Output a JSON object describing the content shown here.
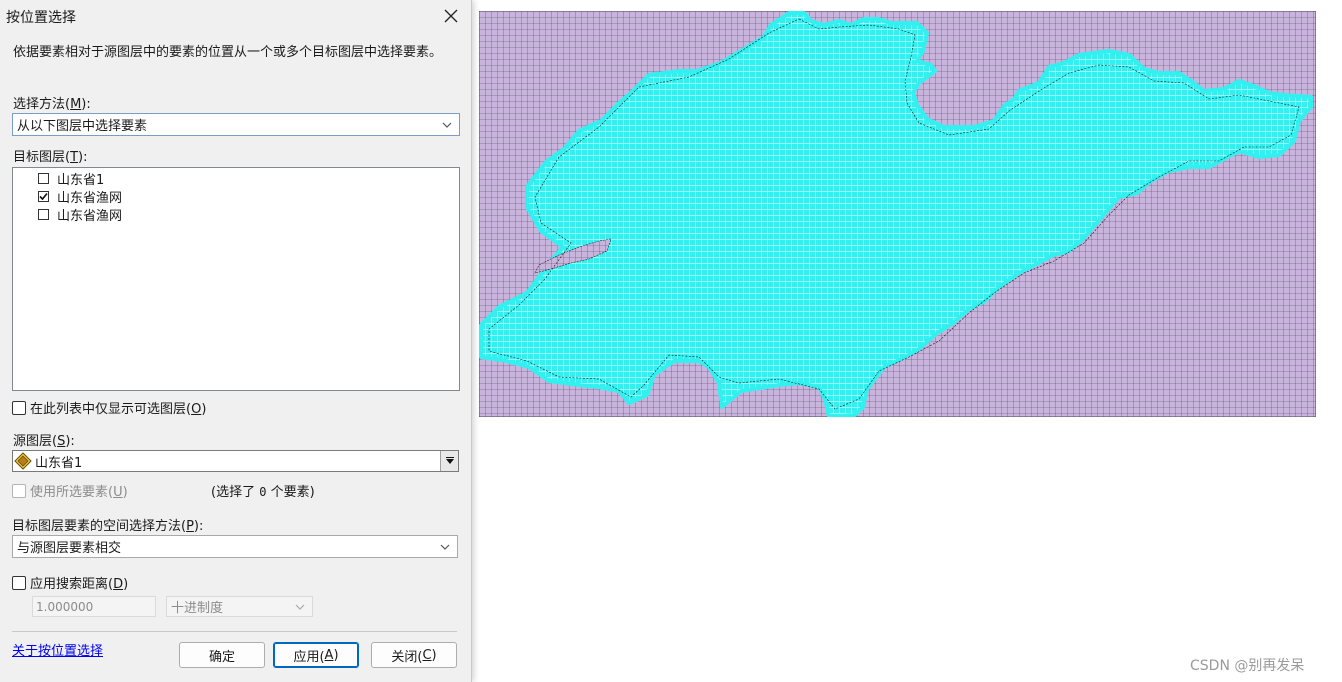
{
  "dialog": {
    "title": "按位置选择",
    "description": "依据要素相对于源图层中的要素的位置从一个或多个目标图层中选择要素。",
    "selection_method": {
      "label": "选择方法(",
      "key": "M",
      "label_end": "):",
      "value": "从以下图层中选择要素"
    },
    "target_layers": {
      "label": "目标图层(",
      "key": "T",
      "label_end": "):",
      "items": [
        {
          "label": "山东省1",
          "checked": false
        },
        {
          "label": "山东省渔网",
          "checked": true
        },
        {
          "label": "山东省渔网",
          "checked": false
        }
      ]
    },
    "only_selectable": {
      "label": "在此列表中仅显示可选图层(",
      "key": "O",
      "label_end": ")",
      "checked": false
    },
    "source_layer": {
      "label": "源图层(",
      "key": "S",
      "label_end": "):",
      "value": "山东省1"
    },
    "use_selected": {
      "label": "使用所选要素(",
      "key": "U",
      "label_end": ")",
      "checked": false,
      "enabled": false,
      "count_pre": "(选择了",
      "count": "0",
      "count_post": "个要素)"
    },
    "spatial_method": {
      "label": "目标图层要素的空间选择方法(",
      "key": "P",
      "label_end": "):",
      "value": "与源图层要素相交"
    },
    "search_distance": {
      "label": "应用搜索距离(",
      "key": "D",
      "label_end": ")",
      "checked": false,
      "value": "1.000000",
      "unit": "十进制度"
    },
    "help_link": "关于按位置选择",
    "buttons": {
      "ok": "确定",
      "apply": "应用(",
      "apply_key": "A",
      "apply_end": ")",
      "close": "关闭(",
      "close_key": "C",
      "close_end": ")"
    }
  },
  "map": {
    "background_color": "#c8b4dc",
    "grid_line_color": "#4a4258",
    "selection_color": "#33f0f0",
    "selection_grid_color": "#ffffff"
  },
  "watermark": "CSDN @别再发呆"
}
